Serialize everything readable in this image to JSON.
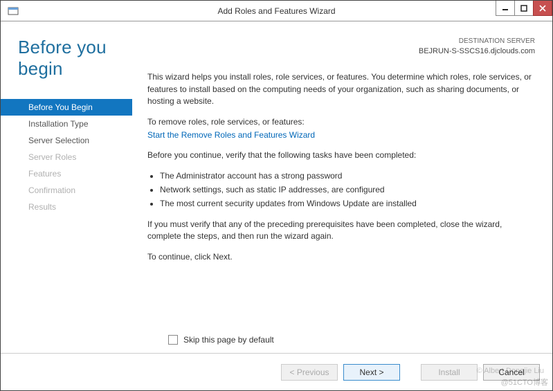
{
  "window": {
    "title": "Add Roles and Features Wizard"
  },
  "header": {
    "page_title": "Before you begin",
    "destination_label": "DESTINATION SERVER",
    "destination_host": "BEJRUN-S-SSCS16.djclouds.com"
  },
  "nav": {
    "items": [
      {
        "label": "Before You Begin",
        "state": "active"
      },
      {
        "label": "Installation Type",
        "state": "enabled"
      },
      {
        "label": "Server Selection",
        "state": "enabled"
      },
      {
        "label": "Server Roles",
        "state": "disabled"
      },
      {
        "label": "Features",
        "state": "disabled"
      },
      {
        "label": "Confirmation",
        "state": "disabled"
      },
      {
        "label": "Results",
        "state": "disabled"
      }
    ]
  },
  "body": {
    "intro": "This wizard helps you install roles, role services, or features. You determine which roles, role services, or features to install based on the computing needs of your organization, such as sharing documents, or hosting a website.",
    "remove_label": "To remove roles, role services, or features:",
    "remove_link": "Start the Remove Roles and Features Wizard",
    "verify_intro": "Before you continue, verify that the following tasks have been completed:",
    "bullets": [
      "The Administrator account has a strong password",
      "Network settings, such as static IP addresses, are configured",
      "The most current security updates from Windows Update are installed"
    ],
    "close_note": "If you must verify that any of the preceding prerequisites have been completed, close the wizard, complete the steps, and then run the wizard again.",
    "continue_note": "To continue, click Next.",
    "skip_label": "Skip this page by default"
  },
  "footer": {
    "previous": "< Previous",
    "next": "Next >",
    "install": "Install",
    "cancel": "Cancel"
  },
  "watermark": {
    "line1": "@51CTO博客",
    "line2": "© Albert Dongjie Liu"
  }
}
